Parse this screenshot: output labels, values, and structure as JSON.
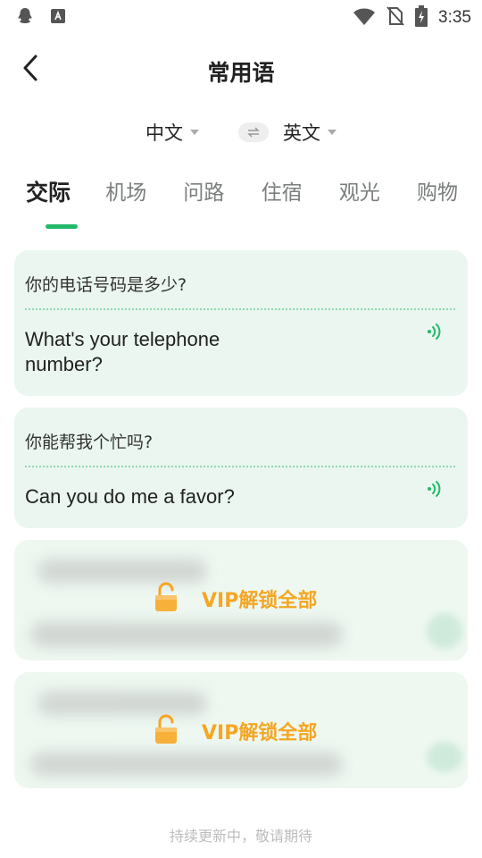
{
  "status_bar": {
    "time": "3:35",
    "icons": [
      "qq-icon",
      "app-store-icon",
      "wifi-icon",
      "no-sim-icon",
      "battery-charging-icon"
    ]
  },
  "header": {
    "title": "常用语",
    "back_icon": "chevron-left-icon"
  },
  "language": {
    "source": "中文",
    "target": "英文",
    "swap_icon": "swap-arrows-icon"
  },
  "tabs": [
    {
      "label": "交际",
      "active": true
    },
    {
      "label": "机场",
      "active": false
    },
    {
      "label": "问路",
      "active": false
    },
    {
      "label": "住宿",
      "active": false
    },
    {
      "label": "观光",
      "active": false
    },
    {
      "label": "购物",
      "active": false
    }
  ],
  "phrases": [
    {
      "zh": "你的电话号码是多少?",
      "en": "What's your telephone number?"
    },
    {
      "zh": "你能帮我个忙吗?",
      "en": "Can you do me a favor?"
    }
  ],
  "locked": [
    {
      "label": "VIP解锁全部"
    },
    {
      "label": "VIP解锁全部"
    }
  ],
  "footer": {
    "note": "持续更新中，敬请期待"
  },
  "colors": {
    "accent": "#22b96a",
    "card_bg": "#eaf6ef",
    "vip": "#f5a623"
  }
}
